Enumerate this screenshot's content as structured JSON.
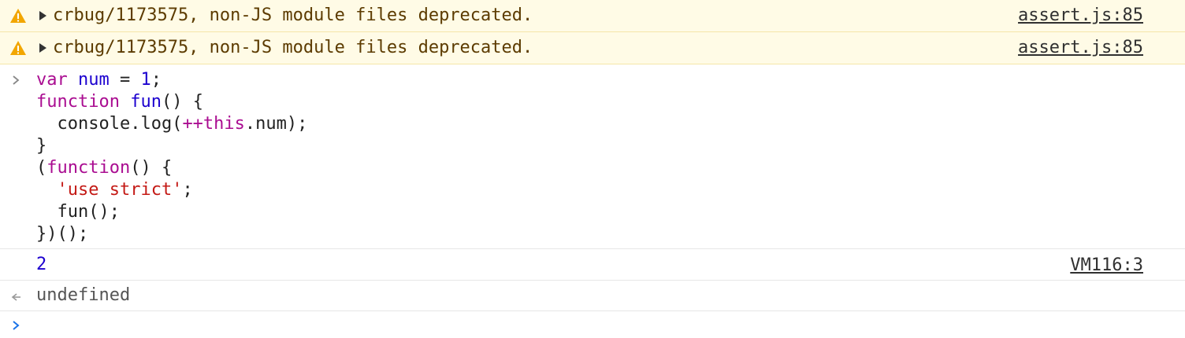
{
  "warnings": [
    {
      "message": "crbug/1173575, non-JS module files deprecated.",
      "source": "assert.js:85"
    },
    {
      "message": "crbug/1173575, non-JS module files deprecated.",
      "source": "assert.js:85"
    }
  ],
  "input": {
    "code_lines": [
      [
        {
          "t": "kw",
          "v": "var"
        },
        {
          "t": "plain",
          "v": " "
        },
        {
          "t": "fn",
          "v": "num"
        },
        {
          "t": "plain",
          "v": " = "
        },
        {
          "t": "num",
          "v": "1"
        },
        {
          "t": "plain",
          "v": ";"
        }
      ],
      [
        {
          "t": "kw",
          "v": "function"
        },
        {
          "t": "plain",
          "v": " "
        },
        {
          "t": "fn",
          "v": "fun"
        },
        {
          "t": "plain",
          "v": "() {"
        }
      ],
      [
        {
          "t": "plain",
          "v": "  console.log("
        },
        {
          "t": "kw",
          "v": "++this"
        },
        {
          "t": "plain",
          "v": ".num);"
        }
      ],
      [
        {
          "t": "plain",
          "v": "}"
        }
      ],
      [
        {
          "t": "plain",
          "v": "("
        },
        {
          "t": "kw",
          "v": "function"
        },
        {
          "t": "plain",
          "v": "() {"
        }
      ],
      [
        {
          "t": "plain",
          "v": "  "
        },
        {
          "t": "str",
          "v": "'use strict'"
        },
        {
          "t": "plain",
          "v": ";"
        }
      ],
      [
        {
          "t": "plain",
          "v": "  fun();"
        }
      ],
      [
        {
          "t": "plain",
          "v": "})();"
        }
      ]
    ]
  },
  "output": {
    "value": "2",
    "source": "VM116:3"
  },
  "return_value": {
    "value": "undefined"
  },
  "icons": {
    "warning": "warning-triangle-icon",
    "expand": "expand-triangle-icon",
    "input_prompt": "chevron-right-icon",
    "return": "return-arrow-icon",
    "new_prompt": "chevron-right-icon"
  },
  "colors": {
    "warning_bg": "#fffbe6",
    "warning_text": "#5c3b00",
    "keyword": "#aa0d91",
    "identifier": "#1c00cf",
    "string": "#c41a16",
    "prompt": "#1a73e8"
  }
}
